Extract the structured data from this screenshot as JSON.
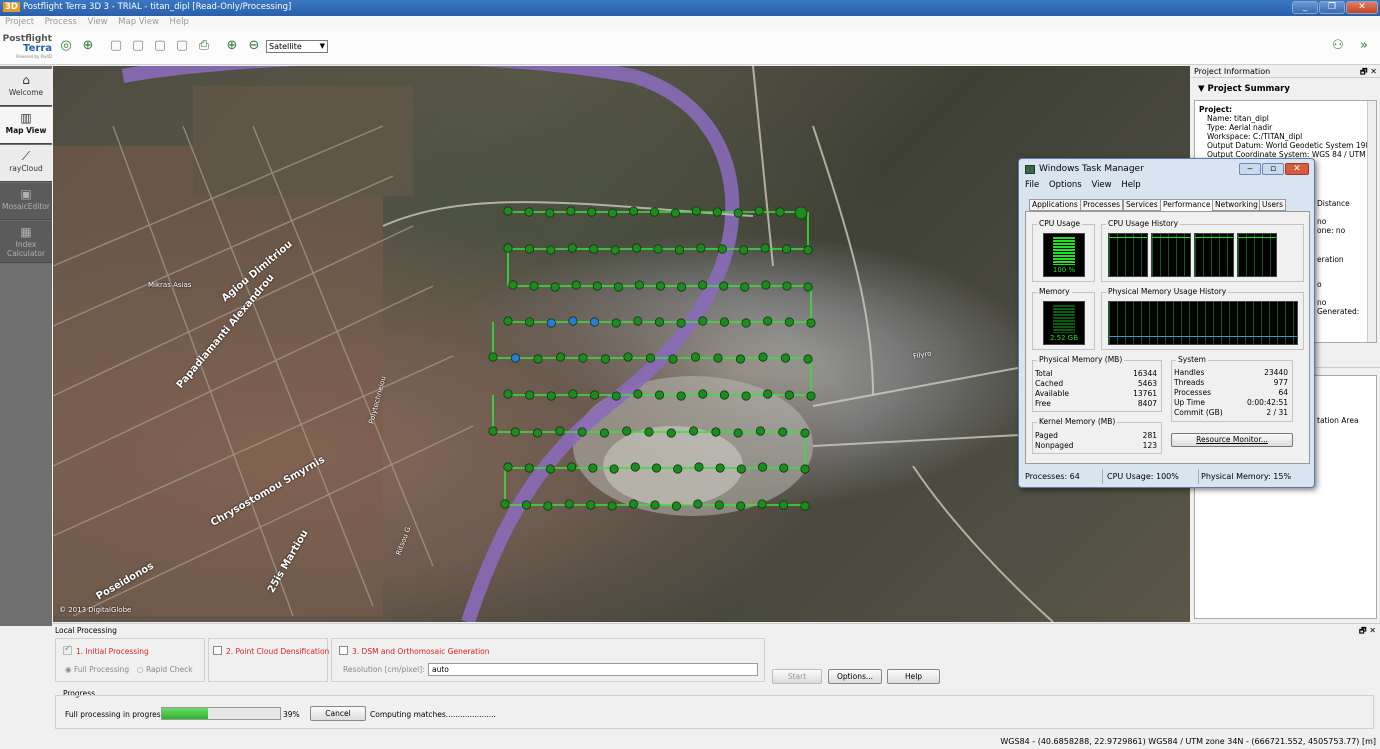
{
  "titlebar": {
    "badge": "3D",
    "title": "Postflight Terra 3D 3 - TRIAL - titan_dipl [Read-Only/Processing]"
  },
  "window_controls": [
    "_",
    "❐",
    "✕"
  ],
  "menu": [
    "Project",
    "Process",
    "View",
    "Map View",
    "Help"
  ],
  "logo": {
    "line1": "Postflight",
    "line2": "Terra",
    "line3": "Powered by Pix4D"
  },
  "toolbar": {
    "basemap": "Satellite"
  },
  "nav": [
    {
      "label": "Welcome",
      "icon": "home-icon"
    },
    {
      "label": "Map View",
      "icon": "map-icon"
    },
    {
      "label": "rayCloud",
      "icon": "raycloud-icon"
    },
    {
      "label": "MosaicEditor",
      "icon": "mosaic-icon"
    },
    {
      "label": "Index Calculator",
      "icon": "calculator-icon"
    }
  ],
  "map": {
    "labels": [
      "Agiou Dimitriou",
      "Papadiamanti Alexandrou",
      "Chrysostomou Smyrnis",
      "Polytechneiou",
      "25is Martiou",
      "Poseidonos",
      "Ritsou G.",
      "Mikras Asias",
      "Filyro",
      "© 2013 DigitalGlobe"
    ],
    "attribution": "© 2013 DigitalGlobe"
  },
  "project_info": {
    "header": "Project Information",
    "summary_title": "Project Summary",
    "lines": [
      "Project:",
      "Name: titan_dipl",
      "Type: Aerial nadir",
      "Workspace: C:/TITAN_dipl",
      "Output Datum: World Geodetic System 1984",
      "Output Coordinate System: WGS 84 / UTM"
    ],
    "partial_right": [
      "Distance",
      "no",
      "one: no",
      "eration",
      "o",
      "no",
      "Generated:",
      "tation Area"
    ]
  },
  "taskmgr": {
    "title": "Windows Task Manager",
    "menu": [
      "File",
      "Options",
      "View",
      "Help"
    ],
    "tabs": [
      "Applications",
      "Processes",
      "Services",
      "Performance",
      "Networking",
      "Users"
    ],
    "cpu_usage_label": "CPU Usage",
    "cpu_usage_value": "100 %",
    "cpu_history_label": "CPU Usage History",
    "memory_label": "Memory",
    "memory_value": "2.52 GB",
    "memory_history_label": "Physical Memory Usage History",
    "physical_memory": {
      "title": "Physical Memory (MB)",
      "rows": [
        [
          "Total",
          "16344"
        ],
        [
          "Cached",
          "5463"
        ],
        [
          "Available",
          "13761"
        ],
        [
          "Free",
          "8407"
        ]
      ]
    },
    "kernel_memory": {
      "title": "Kernel Memory (MB)",
      "rows": [
        [
          "Paged",
          "281"
        ],
        [
          "Nonpaged",
          "123"
        ]
      ]
    },
    "system": {
      "title": "System",
      "rows": [
        [
          "Handles",
          "23440"
        ],
        [
          "Threads",
          "977"
        ],
        [
          "Processes",
          "64"
        ],
        [
          "Up Time",
          "0:00:42:51"
        ],
        [
          "Commit (GB)",
          "2 / 31"
        ]
      ]
    },
    "resource_monitor": "Resource Monitor...",
    "status": [
      "Processes: 64",
      "CPU Usage: 100%",
      "Physical Memory: 15%"
    ]
  },
  "processing": {
    "header": "Local Processing",
    "step1": "1. Initial Processing",
    "step2": "2. Point Cloud Densification",
    "step3": "3. DSM and Orthomosaic Generation",
    "full": "Full Processing",
    "rapid": "Rapid Check",
    "resolution_label": "Resolution [cm/pixel]:",
    "resolution_value": "auto",
    "start": "Start",
    "options": "Options...",
    "help": "Help",
    "progress_label": "Progress",
    "progress_text": "Full processing in progress",
    "progress_fraction": 0.39,
    "progress_pct": "39%",
    "cancel": "Cancel",
    "computing": "Computing matches....................."
  },
  "statusbar": "WGS84 - (40.6858288, 22.9729861)  WGS84 / UTM zone 34N - (666721.552, 4505753.77) [m]"
}
